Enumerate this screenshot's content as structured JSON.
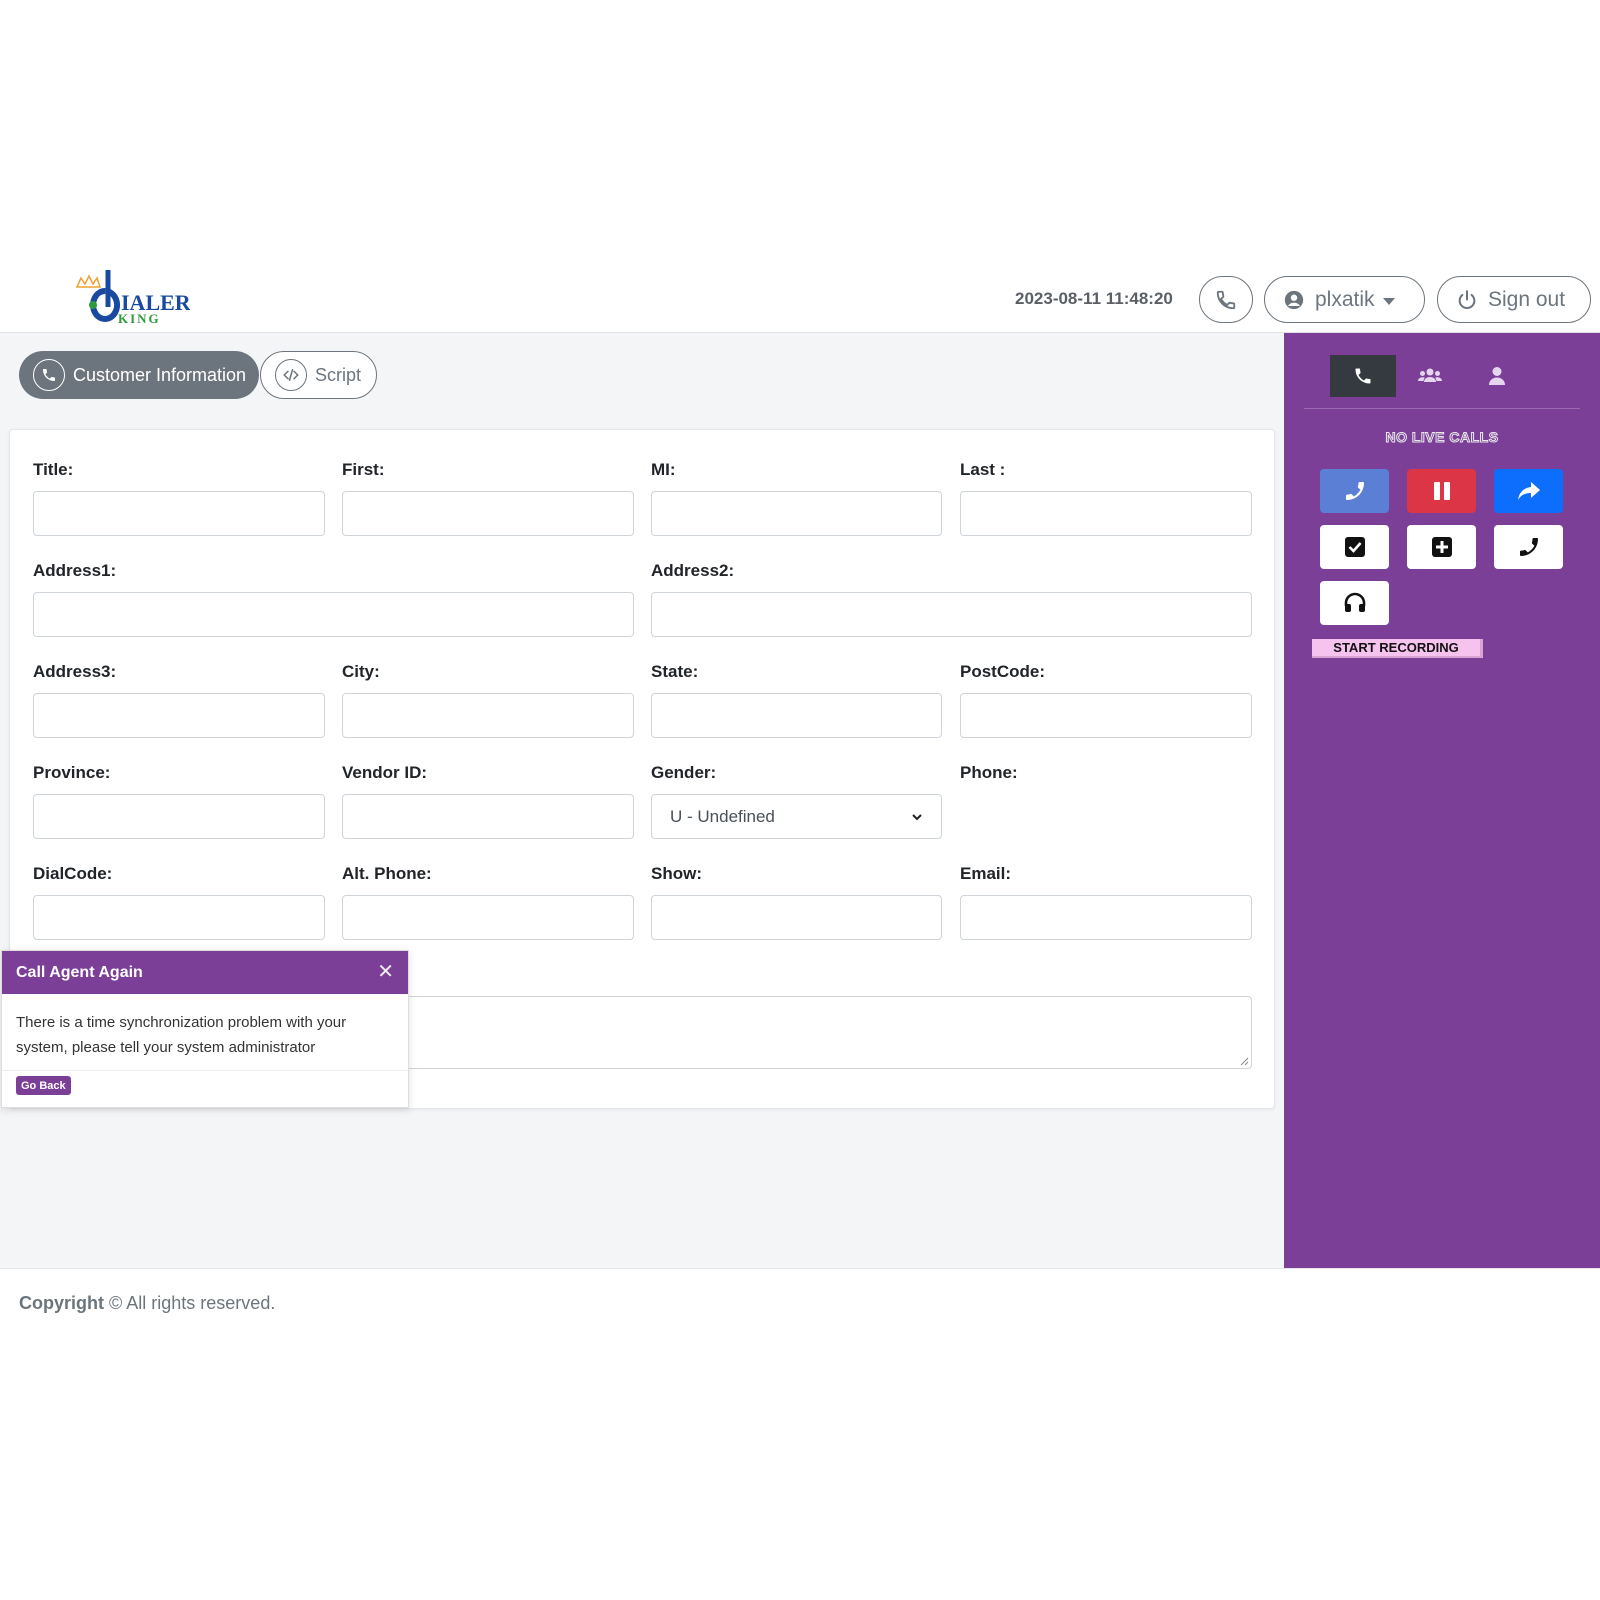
{
  "header": {
    "logo_main": "IALER",
    "logo_sub": "KING",
    "datetime": "2023-08-11 11:48:20",
    "username": "plxatik",
    "signout_label": "Sign out"
  },
  "tabs": [
    {
      "label": "Customer Information",
      "icon": "phone-icon",
      "active": true
    },
    {
      "label": "Script",
      "icon": "code-icon",
      "active": false
    }
  ],
  "form": {
    "title_label": "Title:",
    "first_label": "First:",
    "mi_label": "MI:",
    "last_label": "Last :",
    "address1_label": "Address1:",
    "address2_label": "Address2:",
    "address3_label": "Address3:",
    "city_label": "City:",
    "state_label": "State:",
    "postcode_label": "PostCode:",
    "province_label": "Province:",
    "vendor_label": "Vendor ID:",
    "gender_label": "Gender:",
    "gender_value": "U - Undefined",
    "phone_label": "Phone:",
    "dialcode_label": "DialCode:",
    "altphone_label": "Alt. Phone:",
    "show_label": "Show:",
    "email_label": "Email:"
  },
  "sidebar": {
    "tabs": [
      "phone-icon",
      "users-icon",
      "user-icon"
    ],
    "no_live_calls": "NO LIVE CALLS",
    "controls": [
      {
        "name": "dial-button",
        "icon": "phone-icon",
        "color": "#5c7fd6"
      },
      {
        "name": "pause-button",
        "icon": "pause-icon",
        "color": "#dc3545"
      },
      {
        "name": "transfer-button",
        "icon": "share-icon",
        "color": "#0d6efd"
      },
      {
        "name": "disposition-button",
        "icon": "check-square-icon",
        "color": "#ffffff"
      },
      {
        "name": "add-button",
        "icon": "plus-square-icon",
        "color": "#ffffff"
      },
      {
        "name": "manual-dial-button",
        "icon": "phone-icon",
        "color": "#ffffff"
      },
      {
        "name": "listen-button",
        "icon": "headphones-icon",
        "color": "#ffffff"
      }
    ],
    "start_recording": "START RECORDING"
  },
  "toast": {
    "title": "Call Agent Again",
    "message": "There is a time synchronization problem with your system, please tell your system administrator",
    "button": "Go Back"
  },
  "footer": {
    "copyright_bold": "Copyright",
    "copyright_rest": " © All rights reserved."
  },
  "colors": {
    "brand_purple": "#7b3f98",
    "secondary": "#6c757d"
  }
}
